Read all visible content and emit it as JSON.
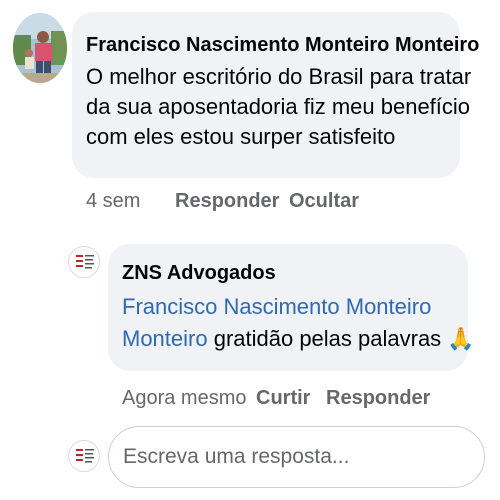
{
  "comment": {
    "author": "Francisco Nascimento Monteiro Monteiro",
    "text_lines": [
      "O melhor escritório do Brasil para tratar",
      "da sua aposentadoria fiz meu benefício",
      "com eles estou surper satisfeito"
    ],
    "time": "4 sem",
    "reply_label": "Responder",
    "hide_label": "Ocultar"
  },
  "reply": {
    "author": "ZNS Advogados",
    "mention_line1": "Francisco Nascimento Monteiro",
    "mention_line2": "Monteiro",
    "text": " gratidão pelas palavras ",
    "emoji": "🙏",
    "time": "Agora mesmo",
    "like_label": "Curtir",
    "reply_label": "Responder"
  },
  "composer": {
    "placeholder": "Escreva uma resposta..."
  },
  "colors": {
    "bubble": "#f0f2f5",
    "mention": "#2e6ab1",
    "meta": "#65676b",
    "logo_red": "#c8202f"
  }
}
